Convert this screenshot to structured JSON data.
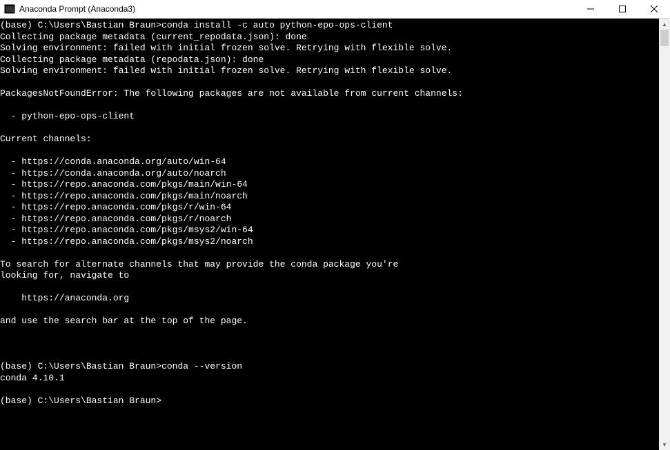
{
  "window": {
    "title": "Anaconda Prompt (Anaconda3)"
  },
  "terminal": {
    "lines": [
      "(base) C:\\Users\\Bastian Braun>conda install -c auto python-epo-ops-client",
      "Collecting package metadata (current_repodata.json): done",
      "Solving environment: failed with initial frozen solve. Retrying with flexible solve.",
      "Collecting package metadata (repodata.json): done",
      "Solving environment: failed with initial frozen solve. Retrying with flexible solve.",
      "",
      "PackagesNotFoundError: The following packages are not available from current channels:",
      "",
      "  - python-epo-ops-client",
      "",
      "Current channels:",
      "",
      "  - https://conda.anaconda.org/auto/win-64",
      "  - https://conda.anaconda.org/auto/noarch",
      "  - https://repo.anaconda.com/pkgs/main/win-64",
      "  - https://repo.anaconda.com/pkgs/main/noarch",
      "  - https://repo.anaconda.com/pkgs/r/win-64",
      "  - https://repo.anaconda.com/pkgs/r/noarch",
      "  - https://repo.anaconda.com/pkgs/msys2/win-64",
      "  - https://repo.anaconda.com/pkgs/msys2/noarch",
      "",
      "To search for alternate channels that may provide the conda package you're",
      "looking for, navigate to",
      "",
      "    https://anaconda.org",
      "",
      "and use the search bar at the top of the page.",
      "",
      "",
      "",
      "(base) C:\\Users\\Bastian Braun>conda --version",
      "conda 4.10.1",
      "",
      "(base) C:\\Users\\Bastian Braun>"
    ]
  }
}
